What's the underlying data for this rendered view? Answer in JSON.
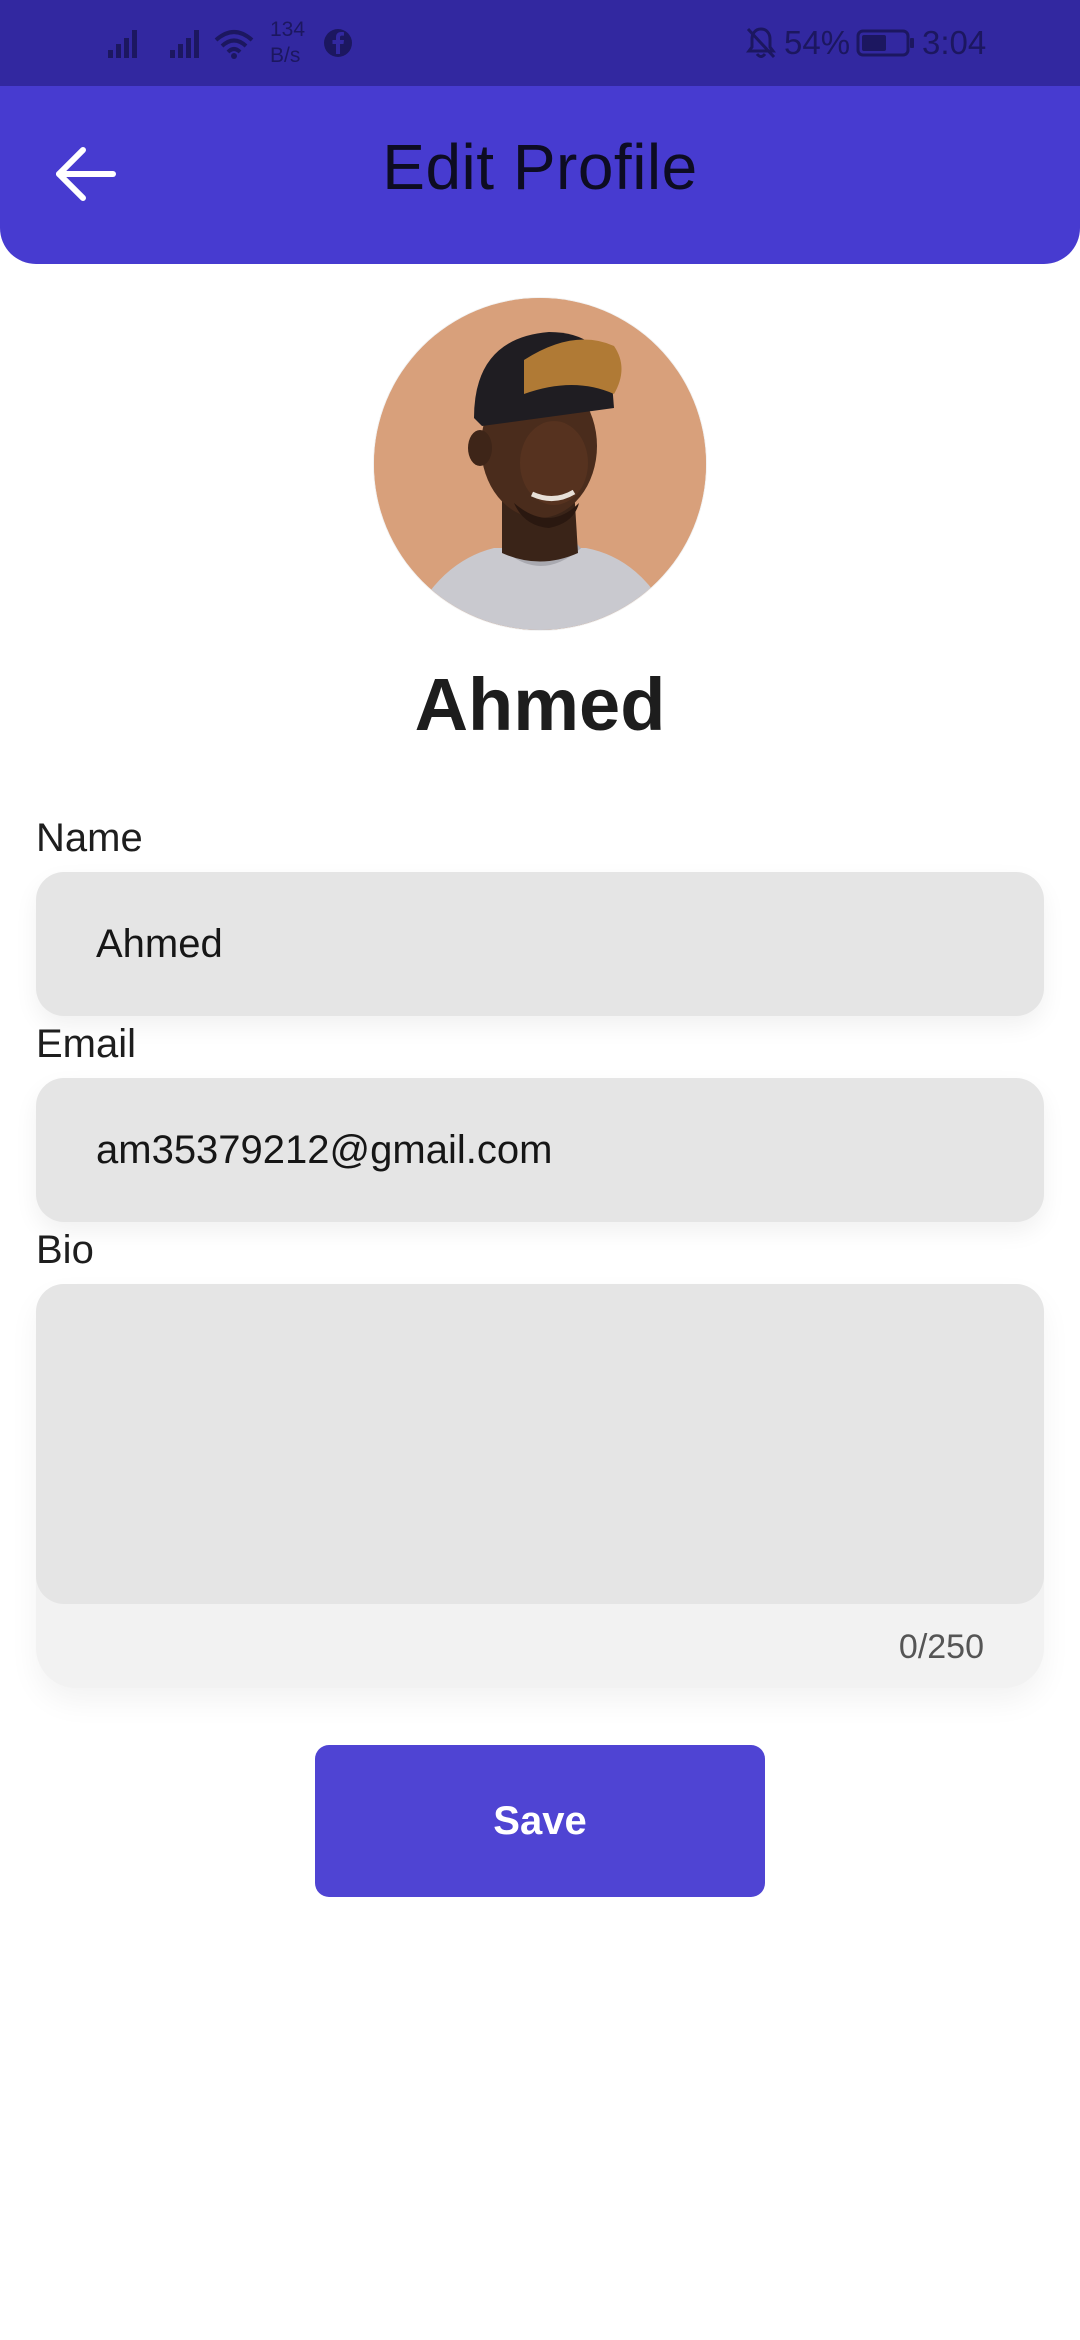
{
  "status_bar": {
    "net_speed_value": "134",
    "net_speed_unit": "B/s",
    "battery_percent": "54%",
    "time": "3:04",
    "icons": [
      "signal-1-icon",
      "signal-2-icon",
      "wifi-icon",
      "facebook-icon",
      "mute-bell-icon",
      "battery-icon"
    ]
  },
  "app_bar": {
    "title": "Edit Profile",
    "back_icon": "arrow-left-icon",
    "color": "#473bd0"
  },
  "profile": {
    "display_name": "Ahmed",
    "avatar_icon": "profile-photo"
  },
  "form": {
    "name": {
      "label": "Name",
      "value": "Ahmed"
    },
    "email": {
      "label": "Email",
      "value": "am35379212@gmail.com"
    },
    "bio": {
      "label": "Bio",
      "value": "",
      "counter": "0/250"
    }
  },
  "actions": {
    "save_label": "Save",
    "save_color": "#4f44d3"
  }
}
